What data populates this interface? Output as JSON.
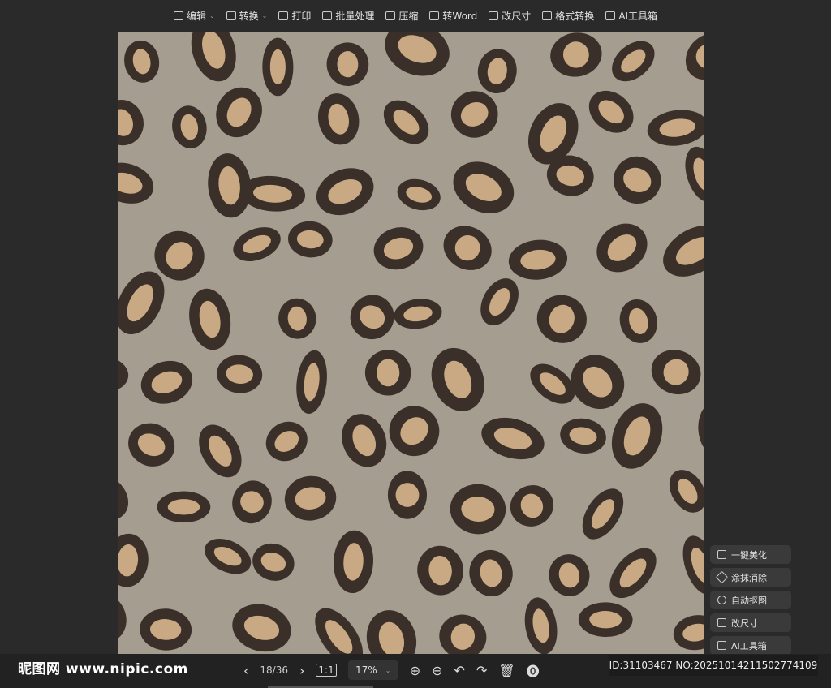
{
  "toolbar": {
    "items": [
      {
        "label": "编辑",
        "icon": "edit-icon",
        "dropdown": true
      },
      {
        "label": "转换",
        "icon": "convert-icon",
        "dropdown": true
      },
      {
        "label": "打印",
        "icon": "print-icon"
      },
      {
        "label": "批量处理",
        "icon": "batch-icon"
      },
      {
        "label": "压缩",
        "icon": "compress-icon"
      },
      {
        "label": "转Word",
        "icon": "word-icon"
      },
      {
        "label": "改尺寸",
        "icon": "resize-icon"
      },
      {
        "label": "格式转换",
        "icon": "format-icon"
      },
      {
        "label": "AI工具箱",
        "icon": "ai-toolbox-icon"
      }
    ]
  },
  "side_panel": {
    "items": [
      {
        "label": "一键美化",
        "icon": "beautify-icon"
      },
      {
        "label": "涂抹消除",
        "icon": "eraser-icon"
      },
      {
        "label": "自动抠图",
        "icon": "cutout-icon"
      },
      {
        "label": "改尺寸",
        "icon": "resize-icon"
      },
      {
        "label": "AI工具箱",
        "icon": "ai-toolbox-icon"
      }
    ]
  },
  "bottom": {
    "logo": "昵图网 www.nipic.com",
    "page": "18/36",
    "zoom": "17%",
    "id_text": "ID:31103467 NO:20251014211502774109"
  },
  "colors": {
    "background": "#2a2a2a",
    "fur": "#a59d90",
    "spot": "#3b3029",
    "spot_inner": "#c9a983"
  }
}
